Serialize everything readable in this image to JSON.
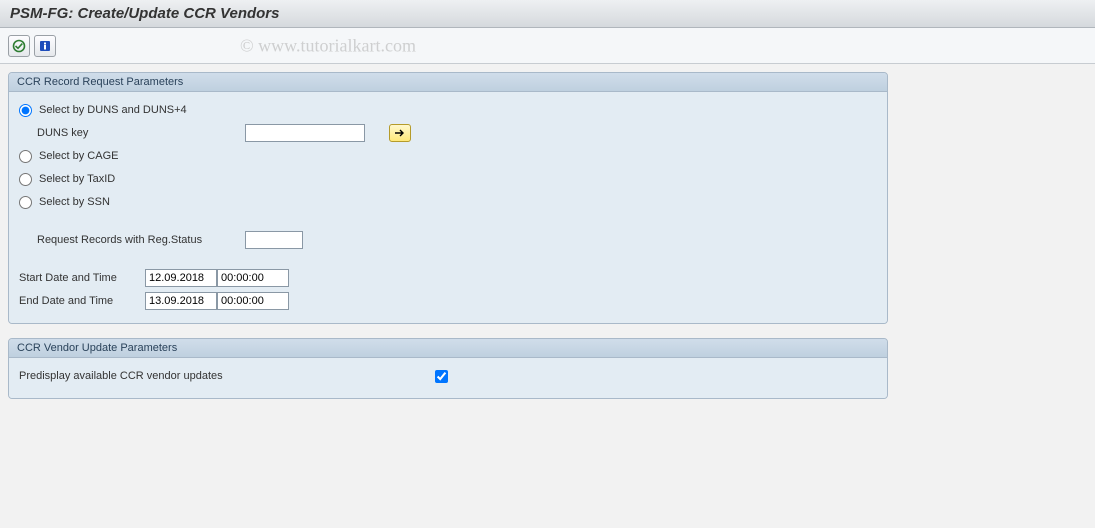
{
  "header": {
    "title": "PSM-FG: Create/Update CCR Vendors"
  },
  "watermark": "© www.tutorialkart.com",
  "group1": {
    "title": "CCR Record Request Parameters",
    "radio_duns": "Select by DUNS and DUNS+4",
    "duns_key_label": "DUNS key",
    "duns_key_value": "",
    "radio_cage": "Select by CAGE",
    "radio_taxid": "Select by TaxID",
    "radio_ssn": "Select by SSN",
    "regstatus_label": "Request Records with Reg.Status",
    "regstatus_value": "",
    "start_label": "Start Date and Time",
    "start_date": "12.09.2018",
    "start_time": "00:00:00",
    "end_label": "End Date and Time",
    "end_date": "13.09.2018",
    "end_time": "00:00:00"
  },
  "group2": {
    "title": "CCR Vendor Update Parameters",
    "predisplay_label": "Predisplay available CCR vendor updates"
  }
}
